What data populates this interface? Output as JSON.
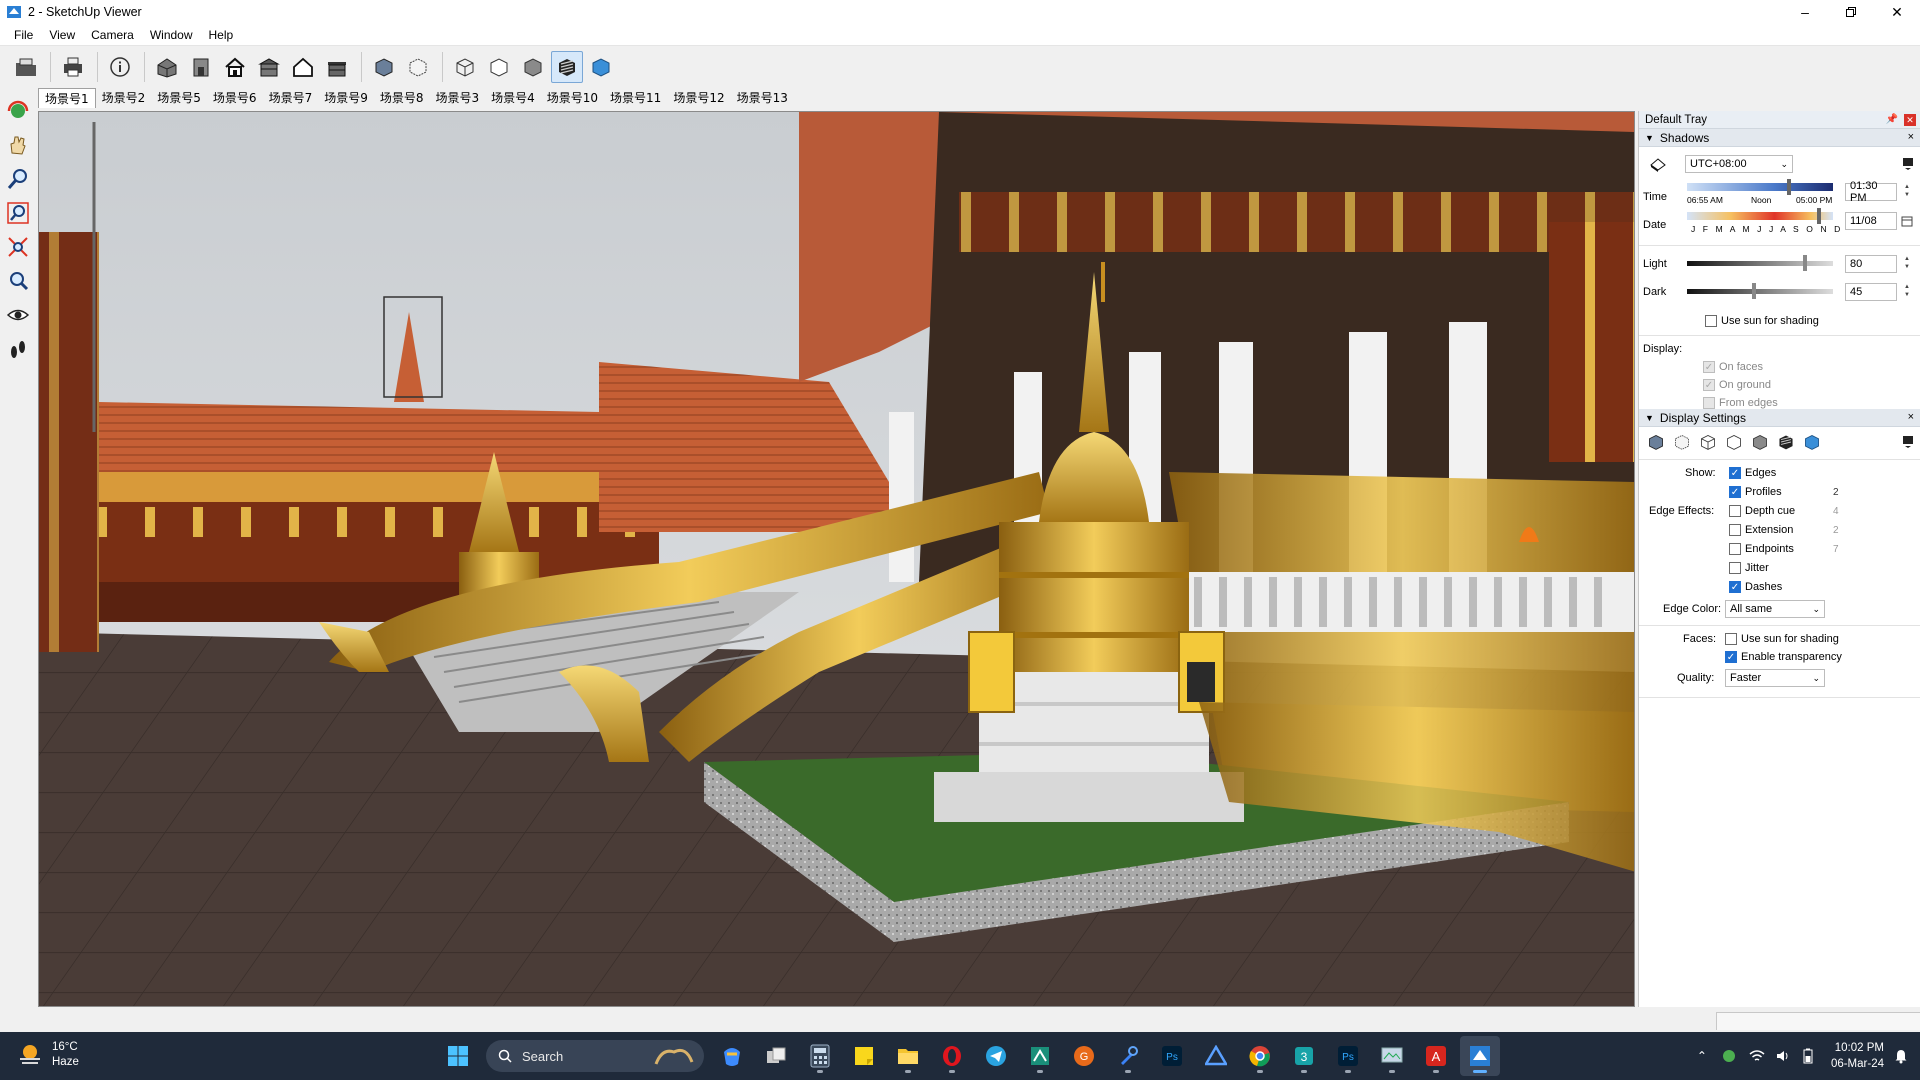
{
  "window": {
    "title": "2 - SketchUp Viewer"
  },
  "menu": {
    "items": [
      "File",
      "View",
      "Camera",
      "Window",
      "Help"
    ]
  },
  "toolbar": {
    "icons": [
      "open-file",
      "print",
      "model-info",
      "iso-view",
      "front-view",
      "home-view",
      "top-view",
      "house-outline",
      "right-view",
      "xray",
      "back-edges",
      "wireframe",
      "hidden-line",
      "shaded",
      "shaded-textures",
      "monochrome"
    ]
  },
  "scenes": [
    "场景号1",
    "场景号2",
    "场景号5",
    "场景号6",
    "场景号7",
    "场景号9",
    "场景号8",
    "场景号3",
    "场景号4",
    "场景号10",
    "场景号11",
    "场景号12",
    "场景号13"
  ],
  "tray": {
    "title": "Default Tray",
    "shadows": {
      "header": "Shadows",
      "timezone": "UTC+08:00",
      "time_label": "Time",
      "time_start": "06:55 AM",
      "time_noon": "Noon",
      "time_end": "05:00 PM",
      "time_value": "01:30 PM",
      "date_label": "Date",
      "months": "J F M A M J J A S O N D",
      "date_value": "11/08",
      "light_label": "Light",
      "light_value": "80",
      "dark_label": "Dark",
      "dark_value": "45",
      "use_sun_label": "Use sun for shading",
      "display_label": "Display:",
      "on_faces": "On faces",
      "on_ground": "On ground",
      "from_edges": "From edges"
    },
    "display_settings": {
      "header": "Display Settings",
      "show_label": "Show:",
      "edges": "Edges",
      "profiles": "Profiles",
      "profiles_val": "2",
      "edge_effects_label": "Edge Effects:",
      "depth_cue": "Depth cue",
      "depth_cue_val": "4",
      "extension": "Extension",
      "extension_val": "2",
      "endpoints": "Endpoints",
      "endpoints_val": "7",
      "jitter": "Jitter",
      "dashes": "Dashes",
      "edge_color_label": "Edge Color:",
      "edge_color_value": "All same",
      "faces_label": "Faces:",
      "faces_use_sun": "Use sun for shading",
      "enable_transparency": "Enable transparency",
      "quality_label": "Quality:",
      "quality_value": "Faster"
    }
  },
  "taskbar": {
    "weather_temp": "16°C",
    "weather_desc": "Haze",
    "search_placeholder": "Search",
    "time": "10:02 PM",
    "date": "06-Mar-24"
  },
  "colors": {
    "accent": "#1f6fd1",
    "taskbar_bg": "#1f2a3a",
    "roof": "#c8643a",
    "gold": "#d8a52a"
  }
}
